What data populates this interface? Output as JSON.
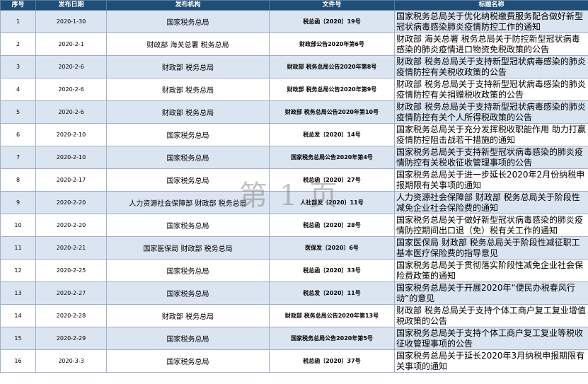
{
  "headers": [
    "序号",
    "发布日期",
    "发布机构",
    "文件号",
    "标题名称"
  ],
  "rows": [
    {
      "no": "1",
      "date": "2020-1-30",
      "agency": "国家税务总局",
      "doc": "税总函〔2020〕19号",
      "title": "国家税务总局关于优化纳税缴费服务配合做好新型冠状病毒感染肺炎疫情防控工作的通知"
    },
    {
      "no": "2",
      "date": "2020-2-1",
      "agency": "财政部  海关总署  税务总局",
      "doc": "财政部公告2020年第6号",
      "title": "财政部 海关总署 税务总局关于防控新型冠状病毒感染的肺炎疫情进口物资免税政策的公告"
    },
    {
      "no": "3",
      "date": "2020-2-6",
      "agency": "财政部  税务总局",
      "doc": "财政部 税务总局公告2020年第8号",
      "title": "财政部 税务总局关于支持新型冠状病毒感染的肺炎疫情防控有关税收政策的公告"
    },
    {
      "no": "4",
      "date": "2020-2-6",
      "agency": "财政部  税务总局",
      "doc": "财政部 税务总局公告2020年第9号",
      "title": "财政部 税务总局关于支持新型冠状病毒感染的肺炎疫情防控有关捐赠税收政策的公告"
    },
    {
      "no": "5",
      "date": "2020-2-6",
      "agency": "财政部  税务总局",
      "doc": "财政部 税务总局公告2020年第10号",
      "title": "财政部 税务总局关于支持新型冠状病毒感染的肺炎疫情防控有关个人所得税政策的公告"
    },
    {
      "no": "6",
      "date": "2020-2-10",
      "agency": "国家税务总局",
      "doc": "税总发〔2020〕14号",
      "title": "国家税务总局关于充分发挥税收职能作用 助力打赢疫情防控阻击战若干措施的通知"
    },
    {
      "no": "7",
      "date": "2020-2-10",
      "agency": "国家税务总局",
      "doc": "国家税务总局公告2020年第4号",
      "title": "国家税务总局关于支持新型冠状病毒感染的肺炎疫情防控有关税收征收管理事项的公告"
    },
    {
      "no": "8",
      "date": "2020-2-17",
      "agency": "国家税务总局",
      "doc": "税总函〔2020〕27号",
      "title": "国家税务总局关于进一步延长2020年2月份纳税申报期限有关事项的通知"
    },
    {
      "no": "9",
      "date": "2020-2-20",
      "agency": "人力资源社会保障部  财政部  税务总局",
      "doc": "人社部发〔2020〕11号",
      "title": "人力资源社会保障部 财政部 税务总局关于阶段性减免企业社会保险费的通知"
    },
    {
      "no": "10",
      "date": "2020-2-20",
      "agency": "国家税务总局",
      "doc": "税总函〔2020〕28号",
      "title": "国家税务总局关于做好新型冠状病毒感染的肺炎疫情防控期间出口退（免）税有关工作的通知"
    },
    {
      "no": "11",
      "date": "2020-2-21",
      "agency": "国家医保局  财政部  税务总局",
      "doc": "医保发〔2020〕6号",
      "title": "国家医保局 财政部 税务总局关于阶段性减征职工基本医疗保险费的指导意见"
    },
    {
      "no": "12",
      "date": "2020-2-25",
      "agency": "国家税务总局",
      "doc": "税总函〔2020〕33号",
      "title": "国家税务总局关于贯彻落实阶段性减免企业社会保险费政策的通知"
    },
    {
      "no": "13",
      "date": "2020-2-27",
      "agency": "国家税务总局",
      "doc": "税总发〔2020〕11号",
      "title": "国家税务总局关于开展2020年“便民办税春风行动”的意见"
    },
    {
      "no": "14",
      "date": "2020-2-28",
      "agency": "财政部  税务总局",
      "doc": "财政部 税务总局公告2020年第13号",
      "title": "财政部 税务总局关于支持个体工商户复工复业增值税政策的公告"
    },
    {
      "no": "15",
      "date": "2020-2-29",
      "agency": "国家税务总局",
      "doc": "国家税务总局公告2020年第5号",
      "title": "国家税务总局关于支持个体工商户复工复业等税收征收管理事项的公告"
    },
    {
      "no": "16",
      "date": "2020-3-3",
      "agency": "国家税务总局",
      "doc": "税总函〔2020〕37号",
      "title": "国家税务总局关于延长2020年3月纳税申报期限有关事项的通知"
    }
  ],
  "watermark": "第 1 页",
  "colors": {
    "header_bg": "#1f4e79",
    "stripe": "#dbe4f1"
  }
}
